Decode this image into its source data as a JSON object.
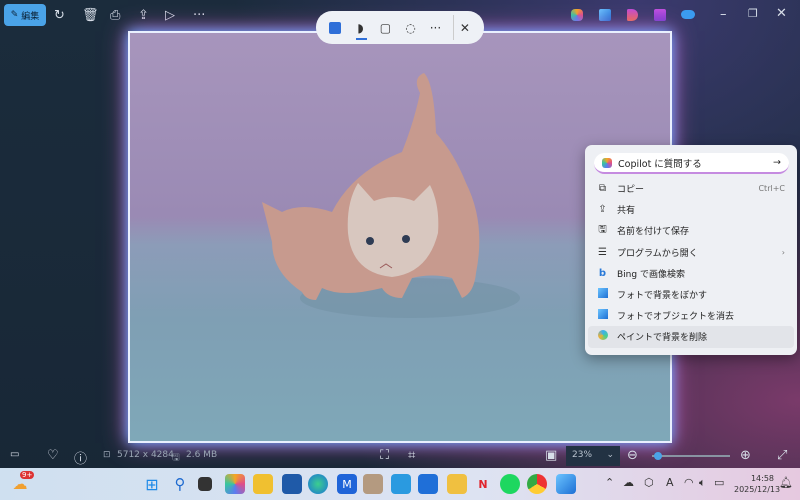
{
  "toolbar": {
    "edit_label": "編集",
    "items": [
      "rotate",
      "delete",
      "print",
      "share",
      "slideshow",
      "more"
    ]
  },
  "floating_toolbar": {
    "items": [
      "ai-select",
      "freeform",
      "rectangle",
      "lasso",
      "more",
      "close"
    ]
  },
  "title_apps": [
    "copilot",
    "photos",
    "clipchamp",
    "clipchamp-video",
    "onedrive"
  ],
  "context_menu": {
    "copilot_placeholder": "Copilot に質問する",
    "items": [
      {
        "label": "コピー",
        "shortcut": "Ctrl+C"
      },
      {
        "label": "共有"
      },
      {
        "label": "名前を付けて保存"
      },
      {
        "label": "プログラムから開く",
        "submenu": "›"
      },
      {
        "label": "Bing で画像検索"
      },
      {
        "label": "フォトで背景をぼかす"
      },
      {
        "label": "フォトでオブジェクトを消去"
      },
      {
        "label": "ペイントで背景を削除"
      }
    ]
  },
  "status": {
    "dimensions": "5712 x 4284",
    "size": "2.6 MB",
    "zoom": "23%",
    "zoom_fraction": 0.05
  },
  "taskbar": {
    "badge": "9+",
    "time": "14:58",
    "date": "2025/12/13"
  },
  "colors": {
    "accent": "#4aa3e8",
    "background": "#1a2838"
  }
}
